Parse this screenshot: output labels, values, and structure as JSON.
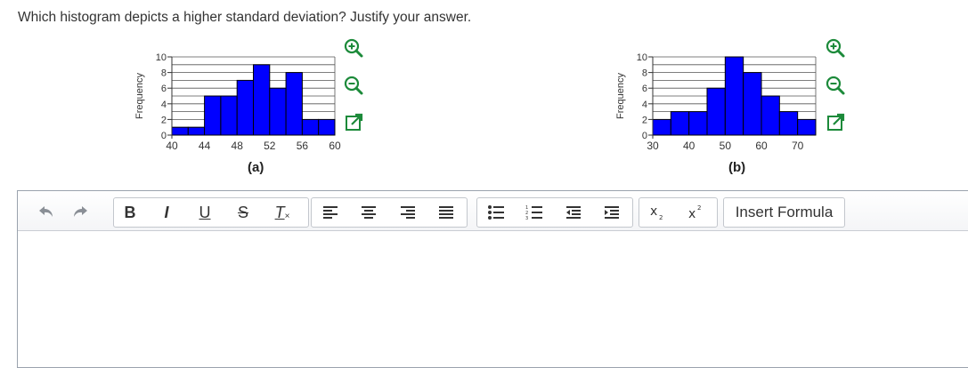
{
  "question": "Which histogram depicts a higher standard deviation? Justify your answer.",
  "chart_data": [
    {
      "type": "bar",
      "caption": "(a)",
      "ylabel": "Frequency",
      "bin_edges": [
        40,
        42,
        44,
        46,
        48,
        50,
        52,
        54,
        56,
        58,
        60
      ],
      "values": [
        1,
        1,
        5,
        5,
        7,
        9,
        6,
        8,
        2,
        2
      ],
      "ylim": [
        0,
        10
      ],
      "yticks": [
        0,
        2,
        4,
        6,
        8,
        10
      ],
      "xlim": [
        40,
        60
      ],
      "xticks": [
        40,
        44,
        48,
        52,
        56,
        60
      ],
      "grid": true,
      "bar_color": "#0000ff"
    },
    {
      "type": "bar",
      "caption": "(b)",
      "ylabel": "Frequency",
      "bin_edges": [
        30,
        35,
        40,
        45,
        50,
        55,
        60,
        65,
        70,
        75
      ],
      "values": [
        2,
        3,
        3,
        6,
        10,
        8,
        5,
        3,
        2
      ],
      "ylim": [
        0,
        10
      ],
      "yticks": [
        0,
        2,
        4,
        6,
        8,
        10
      ],
      "xlim": [
        30,
        75
      ],
      "xticks": [
        30,
        40,
        50,
        60,
        70
      ],
      "grid": true,
      "bar_color": "#0000ff"
    }
  ],
  "chart_controls": [
    "zoom-in-icon",
    "zoom-out-icon",
    "expand-icon"
  ],
  "toolbar": {
    "undo_icon": "undo-icon",
    "redo_icon": "redo-icon",
    "bold": "B",
    "italic": "I",
    "underline": "U",
    "strikethrough": "S",
    "clear_format": "T",
    "align_icons": [
      "align-left-icon",
      "align-center-icon",
      "align-right-icon",
      "align-justify-icon"
    ],
    "list_icons": [
      "bullet-list-icon",
      "numbered-list-icon",
      "outdent-icon",
      "indent-icon"
    ],
    "subscript_icon": "subscript-icon",
    "superscript_icon": "superscript-icon",
    "insert_formula": "Insert Formula"
  },
  "colors": {
    "bars": "#0000ff",
    "zoom_icon": "#1c8a3a",
    "expand_icon": "#1c8a3a",
    "toolbar_border": "#c3c7cd"
  }
}
